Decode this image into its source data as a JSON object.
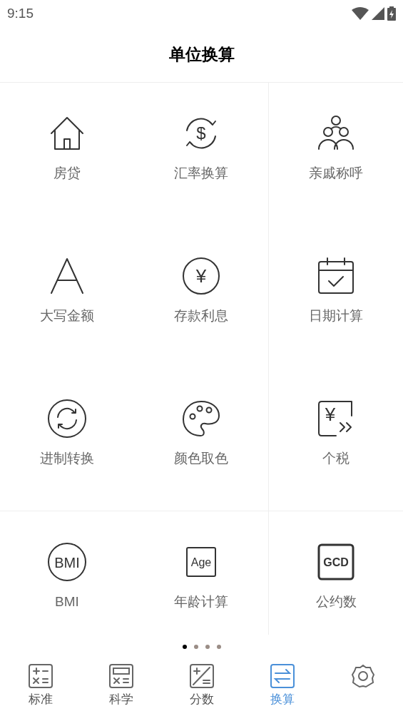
{
  "status_bar": {
    "time": "9:15"
  },
  "header": {
    "title": "单位换算"
  },
  "grid": [
    {
      "kind": "house",
      "label": "房贷"
    },
    {
      "kind": "exchange",
      "label": "汇率换算",
      "icon_text": "$"
    },
    {
      "kind": "family",
      "label": "亲戚称呼"
    },
    {
      "kind": "letter",
      "label": "大写金额"
    },
    {
      "kind": "coin",
      "label": "存款利息",
      "icon_text": "¥"
    },
    {
      "kind": "calendar",
      "label": "日期计算"
    },
    {
      "kind": "refresh",
      "label": "进制转换"
    },
    {
      "kind": "palette",
      "label": "颜色取色"
    },
    {
      "kind": "tax",
      "label": "个税",
      "icon_text": "¥"
    },
    {
      "kind": "bmi",
      "label": "BMI",
      "icon_text": "BMI"
    },
    {
      "kind": "age",
      "label": "年龄计算",
      "icon_text": "Age"
    },
    {
      "kind": "gcd",
      "label": "公约数",
      "icon_text": "GCD"
    }
  ],
  "pager": [
    {
      "selected": true
    },
    {
      "selected": false
    },
    {
      "selected": false
    },
    {
      "selected": false
    }
  ],
  "tabs": [
    {
      "kind": "standard",
      "label": "标准",
      "selected": false
    },
    {
      "kind": "scientific",
      "label": "科学",
      "selected": false
    },
    {
      "kind": "fraction",
      "label": "分数",
      "selected": false
    },
    {
      "kind": "convert",
      "label": "换算",
      "selected": true
    },
    {
      "kind": "settings",
      "selected": false
    }
  ]
}
